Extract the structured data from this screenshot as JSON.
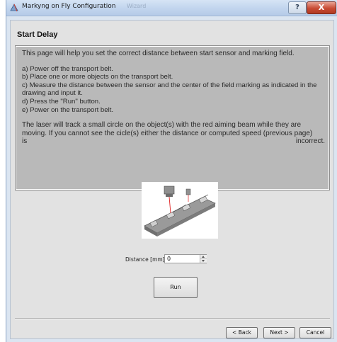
{
  "window": {
    "title": "Markyng on Fly Configuration",
    "ghost_title": "Wizard",
    "help_label": "?",
    "close_label": "X"
  },
  "page": {
    "title": "Start Delay",
    "intro": "This page will help you set the correct distance between start sensor and marking field.",
    "steps": [
      "a) Power off the transport belt.",
      "b) Place one or more objects on the transport belt.",
      "c) Measure the distance between the sensor and the center of the field marking as indicated in the drawing and input it.",
      "d) Press the \"Run\" button.",
      "e) Power on the transport belt."
    ],
    "note": "The laser will track a small circle on the object(s) with the red aiming beam while they are moving. If you cannot see the cicle(s) either the distance or computed speed (previous page)",
    "note_end_left": "is",
    "note_end_right": "incorrect."
  },
  "distance": {
    "label": "Distance [mm]:",
    "value": "0"
  },
  "buttons": {
    "run": "Run",
    "back": "< Back",
    "next": "Next >",
    "cancel": "Cancel"
  },
  "icons": {
    "app": "laser-app-icon",
    "help": "help-icon",
    "close": "close-icon",
    "diagram": "conveyor-belt-diagram"
  },
  "colors": {
    "close_button": "#c84b34",
    "panel_bg": "#b9b9b9",
    "client_bg": "#e2e2e2"
  }
}
